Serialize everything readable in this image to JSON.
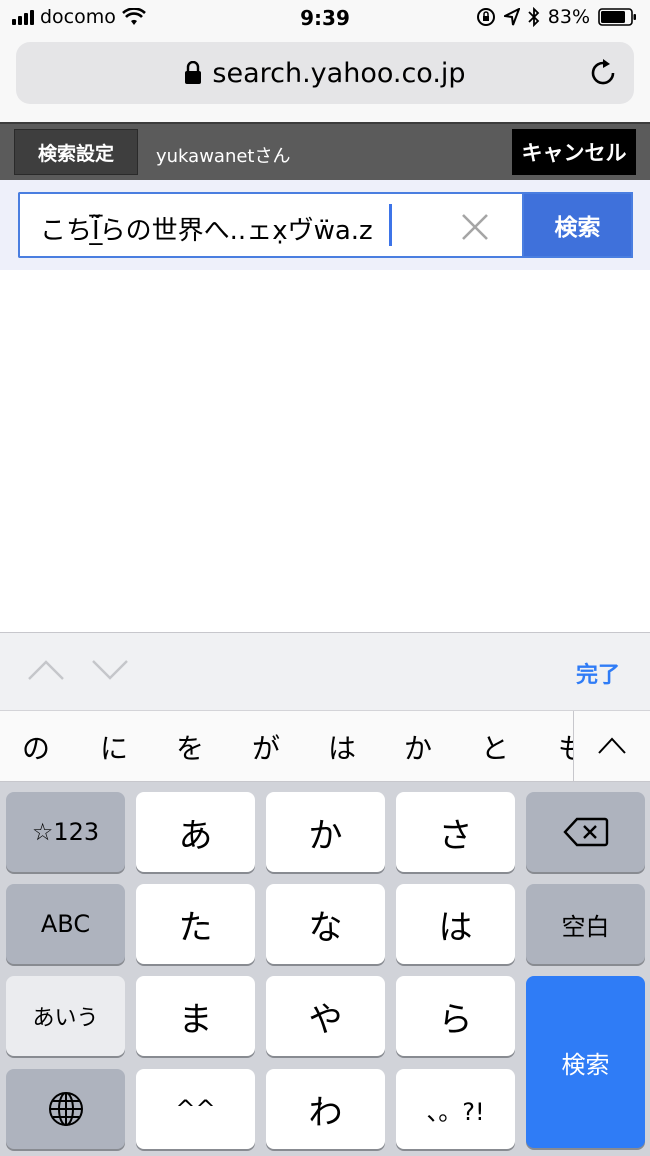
{
  "status_bar": {
    "carrier": "docomo",
    "time": "9:39",
    "battery": "83%"
  },
  "browser": {
    "url": "search.yahoo.co.jp"
  },
  "header": {
    "settings_label": "検索設定",
    "user": "yukawanetさん",
    "cancel_label": "キャンセル"
  },
  "search": {
    "query": "こちI̲̅̃らの世界へ..ェx̣ヴẅa.z",
    "button_label": "検索"
  },
  "accessory": {
    "done_label": "完了"
  },
  "suggestions": [
    "の",
    "に",
    "を",
    "が",
    "は",
    "か",
    "と",
    "も"
  ],
  "keyboard": {
    "row1": [
      "☆123",
      "あ",
      "か",
      "さ"
    ],
    "row2": [
      "ABC",
      "た",
      "な",
      "は",
      "空白"
    ],
    "row3": [
      "あいう",
      "ま",
      "や",
      "ら"
    ],
    "row4": [
      "^^",
      "わ",
      "、。?!"
    ],
    "enter_label": "検索"
  },
  "colors": {
    "accent": "#3f71db",
    "header_bg": "#5b5b5b",
    "link_blue": "#2f7cf6"
  }
}
